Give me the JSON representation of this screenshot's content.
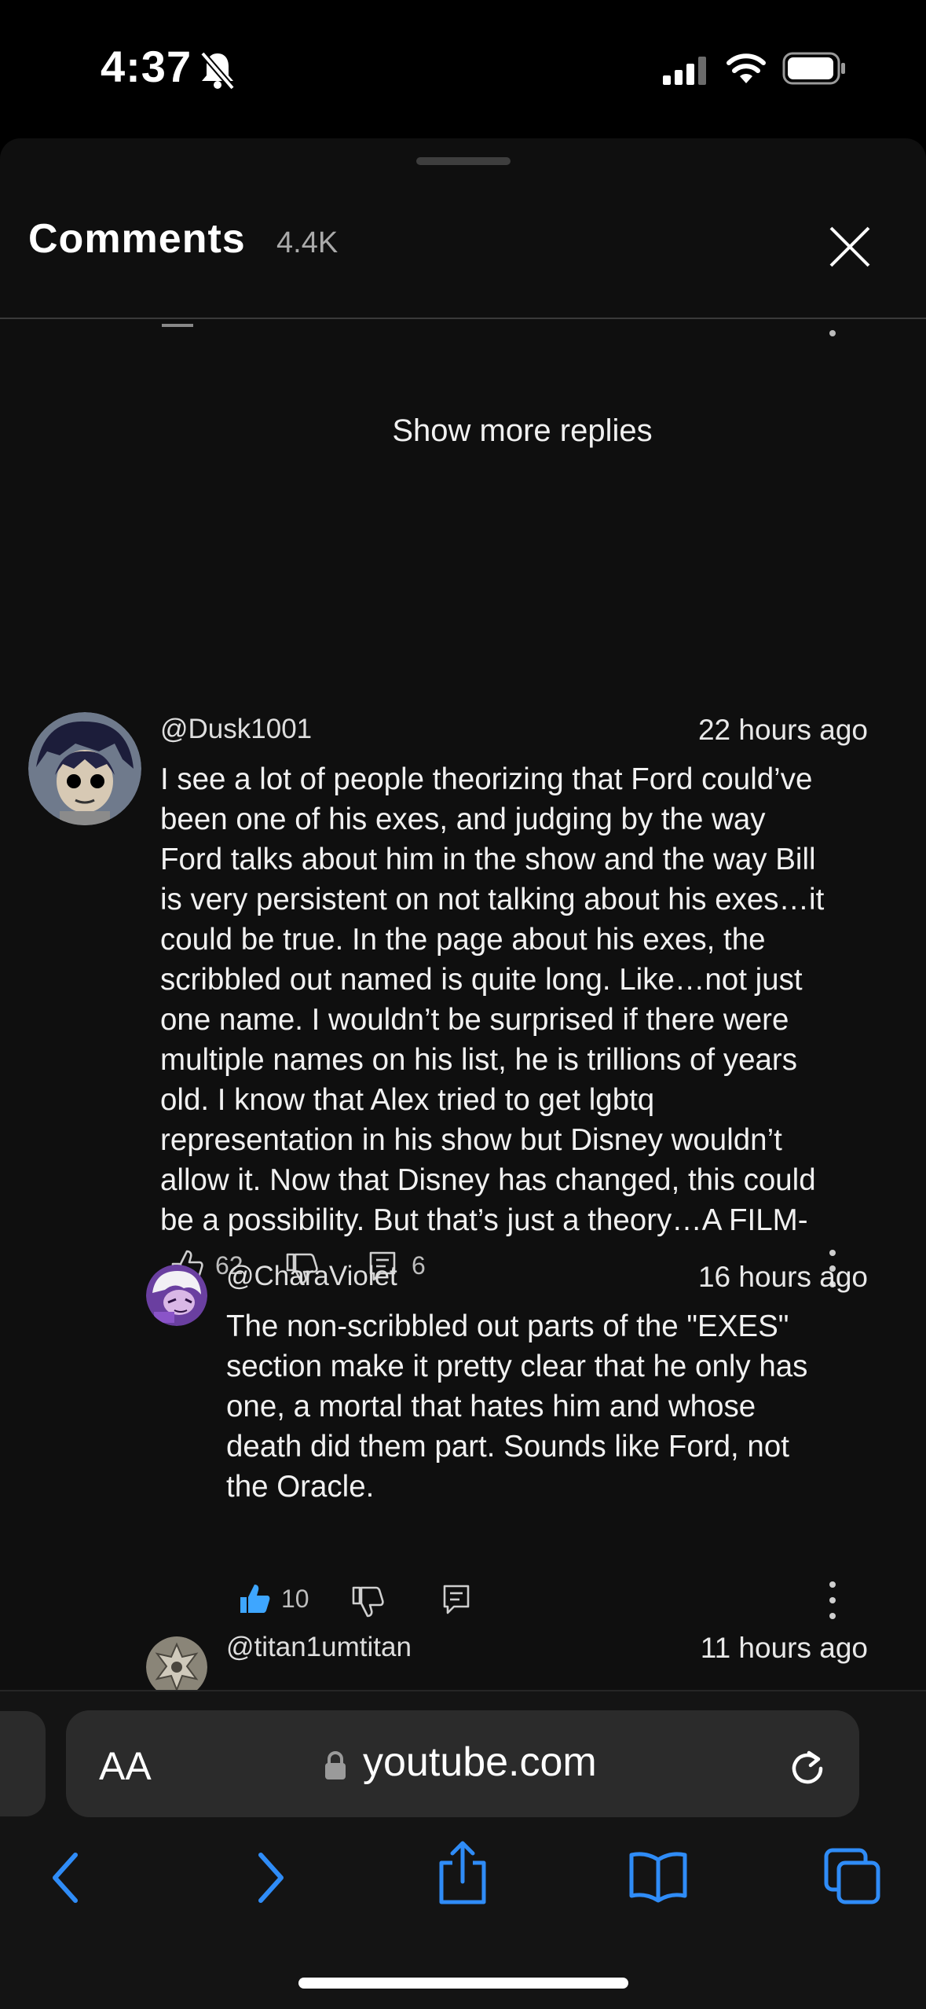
{
  "status_bar": {
    "time": "4:37"
  },
  "sheet": {
    "title": "Comments",
    "count": "4.4K",
    "show_more_label": "Show more replies"
  },
  "comments": [
    {
      "handle": "@Dusk1001",
      "time_ago": "22 hours ago",
      "lines": [
        "I see a lot of people theorizing that Ford could’ve",
        "been one of his exes, and judging by the way",
        "Ford talks about him in the show and the way Bill",
        "is very persistent on not talking about his exes…it",
        "could be true. In the page about his exes, the",
        "scribbled out named is quite long. Like…not just",
        "one name. I wouldn’t be surprised if there were",
        "multiple names on his list, he is trillions of years",
        "old. I know that Alex tried to get lgbtq",
        "representation in his show but Disney wouldn’t",
        "allow it. Now that Disney has changed, this could",
        "be a possibility. But that’s just a theory…A FILM-"
      ],
      "likes": "62",
      "replies": "6"
    },
    {
      "handle": "@CharaViolet",
      "time_ago": "16 hours ago",
      "lines": [
        "The non-scribbled out parts of the \"EXES\"",
        "section make it pretty clear that he only has",
        "one, a mortal that hates him and whose",
        "death did them part. Sounds like Ford, not",
        "the Oracle."
      ],
      "likes": "10",
      "liked": true
    },
    {
      "handle": "@titan1umtitan",
      "time_ago": "11 hours ago"
    }
  ],
  "browser": {
    "text_size_label": "AA",
    "url": "youtube.com"
  },
  "colors": {
    "accent_blue": "#3ea6ff",
    "safari_blue": "#2f8cf7"
  },
  "icons": [
    "mute-bell-icon",
    "signal-icon",
    "wifi-icon",
    "battery-icon",
    "close-icon",
    "like-icon",
    "dislike-icon",
    "reply-icon",
    "more-icon",
    "lock-icon",
    "reload-icon",
    "back-icon",
    "forward-icon",
    "share-icon",
    "bookmarks-icon",
    "tabs-icon"
  ]
}
